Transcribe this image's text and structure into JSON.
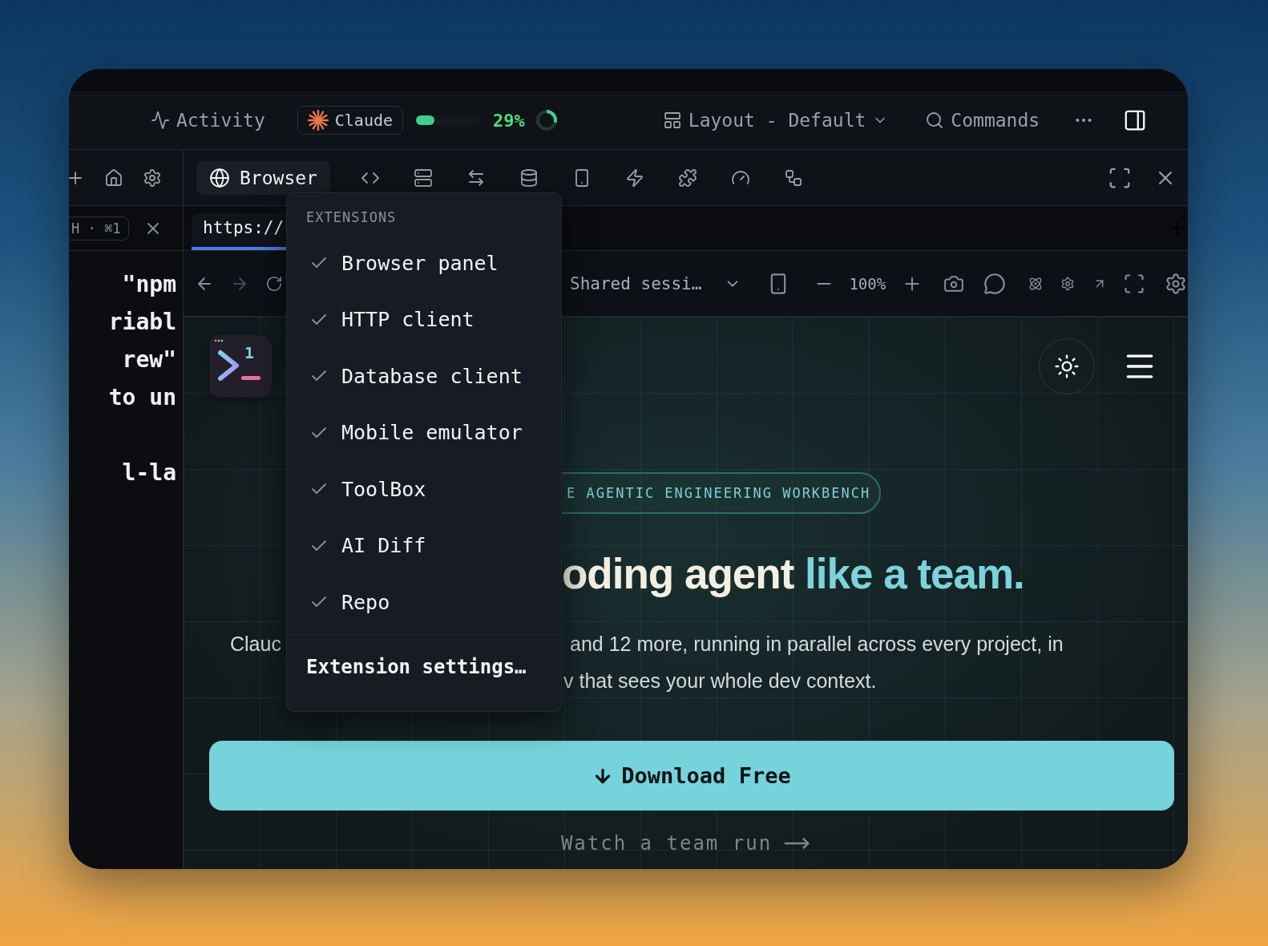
{
  "top_bar": {
    "activity": "Activity",
    "agent": "Claude",
    "progress": {
      "level": 0.29,
      "reading": "29%"
    },
    "layout": "Layout - Default",
    "commands": "Commands"
  },
  "left_pane": {
    "session_chip": "H · ⌘1",
    "editor_blocks": [
      [
        "\"npm",
        "riabl",
        "rew\"",
        "to un"
      ],
      [
        "l-la"
      ]
    ]
  },
  "panel_tab": {
    "label": "Browser",
    "selected": true
  },
  "url_tab": {
    "text": "https://",
    "selected": true
  },
  "nav_bar": {
    "session": "Shared sessi…",
    "zoom": "100%"
  },
  "page": {
    "logo_badge": "1",
    "pill": "E AGENTIC ENGINEERING WORKBENCH",
    "headline": "oding agent",
    "headline_accent": "like a team.",
    "para_left": "Clauc",
    "para_line_1": "and 12 more, running in parallel across every project, in",
    "para_line_2": "v that sees your whole dev context.",
    "download": "Download Free",
    "watch": "Watch a team run"
  },
  "extensions_menu": {
    "header": "EXTENSIONS",
    "items": [
      {
        "label": "Browser panel",
        "checked": true
      },
      {
        "label": "HTTP client",
        "checked": true
      },
      {
        "label": "Database client",
        "checked": true
      },
      {
        "label": "Mobile emulator",
        "checked": true
      },
      {
        "label": "ToolBox",
        "checked": true
      },
      {
        "label": "AI Diff",
        "checked": true
      },
      {
        "label": "Repo",
        "checked": true
      }
    ],
    "settings": "Extension settings…"
  }
}
